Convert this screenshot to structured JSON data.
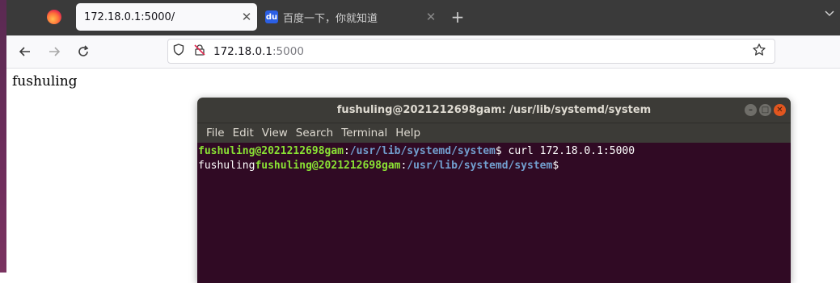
{
  "browser": {
    "tabs": [
      {
        "title": "172.18.0.1:5000/",
        "active": true
      },
      {
        "title": "百度一下，你就知道",
        "active": false
      }
    ],
    "url": {
      "host": "172.18.0.1",
      "port": ":5000"
    },
    "page_text": "fushuling"
  },
  "terminal": {
    "title": "fushuling@2021212698gam: /usr/lib/systemd/system",
    "menu": [
      "File",
      "Edit",
      "View",
      "Search",
      "Terminal",
      "Help"
    ],
    "lines": [
      {
        "prefix_output": "",
        "user_host": "fushuling@2021212698gam",
        "sep": ":",
        "path": "/usr/lib/systemd/system",
        "prompt": "$",
        "command": " curl 172.18.0.1:5000"
      },
      {
        "prefix_output": "fushuling",
        "user_host": "fushuling@2021212698gam",
        "sep": ":",
        "path": "/usr/lib/systemd/system",
        "prompt": "$",
        "command": ""
      }
    ]
  },
  "icons": {
    "firefox": "firefox-logo-icon",
    "baidu": "baidu-favicon-icon",
    "close": "close-icon",
    "new_tab": "plus-icon",
    "tab_list": "chevron-down-icon",
    "back": "arrow-left-icon",
    "forward": "arrow-right-icon",
    "reload": "reload-icon",
    "shield": "shield-icon",
    "insecure_lock": "insecure-lock-icon",
    "bookmark": "star-icon"
  },
  "colors": {
    "terminal_bg": "#300a24",
    "prompt_user": "#8ae234",
    "prompt_path": "#729fcf",
    "titlebar": "#3c3b37",
    "close_button": "#e2561f"
  }
}
